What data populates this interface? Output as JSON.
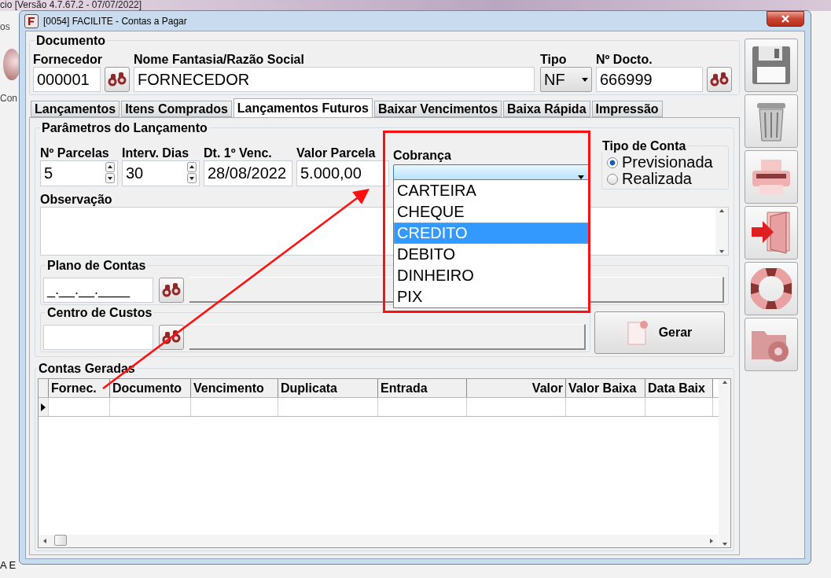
{
  "background_app": {
    "title": "cio [Versão 4.7.67.2 - 07/07/2022]",
    "side_texts": [
      "os",
      "Con"
    ],
    "status_text": "A E"
  },
  "window": {
    "title": "[0054] FACILITE - Contas a Pagar"
  },
  "documento": {
    "title": "Documento",
    "fields": [
      {
        "label": "Fornecedor",
        "value": "000001",
        "kind": "text",
        "lookup": true
      },
      {
        "label": "Nome Fantasia/Razão Social",
        "value": "FORNECEDOR",
        "kind": "text",
        "lookup": false
      },
      {
        "label": "Tipo",
        "value": "NF",
        "kind": "select",
        "lookup": false
      },
      {
        "label": "Nº Docto.",
        "value": "666999",
        "kind": "text",
        "lookup": true
      }
    ]
  },
  "tabs": [
    {
      "label": "Lançamentos",
      "selected": false
    },
    {
      "label": "Itens Comprados",
      "selected": false
    },
    {
      "label": "Lançamentos Futuros",
      "selected": true
    },
    {
      "label": "Baixar Vencimentos",
      "selected": false
    },
    {
      "label": "Baixa Rápida",
      "selected": false
    },
    {
      "label": "Impressão",
      "selected": false
    }
  ],
  "parametros": {
    "title": "Parâmetros do Lançamento",
    "fields": [
      {
        "label": "Nº Parcelas",
        "value": "5",
        "kind": "spin"
      },
      {
        "label": "Interv. Dias",
        "value": "30",
        "kind": "spin"
      },
      {
        "label": "Dt. 1º Venc.",
        "value": "28/08/2022",
        "kind": "text"
      },
      {
        "label": "Valor Parcela",
        "value": "5.000,00",
        "kind": "text"
      }
    ],
    "cobranca": {
      "label": "Cobrança",
      "expanded": true,
      "options": [
        {
          "label": "CARTEIRA",
          "selected": false
        },
        {
          "label": "CHEQUE",
          "selected": false
        },
        {
          "label": "CREDITO",
          "selected": true
        },
        {
          "label": "DEBITO",
          "selected": false
        },
        {
          "label": "DINHEIRO",
          "selected": false
        },
        {
          "label": "PIX",
          "selected": false
        }
      ]
    },
    "tipo_conta": {
      "title": "Tipo de Conta",
      "options": [
        {
          "label": "Previsionada",
          "selected": true
        },
        {
          "label": "Realizada",
          "selected": false
        }
      ]
    },
    "observacao": {
      "label": "Observação"
    },
    "plano_contas": {
      "title": "Plano de Contas",
      "value": "_.__.__.____"
    },
    "centro_custos": {
      "title": "Centro de Custos"
    },
    "gerar_button": "Gerar"
  },
  "contas_geradas": {
    "title": "Contas Geradas",
    "columns": [
      {
        "label": "Fornec.",
        "kind": "text"
      },
      {
        "label": "Documento",
        "kind": "text"
      },
      {
        "label": "Vencimento",
        "kind": "text"
      },
      {
        "label": "Duplicata",
        "kind": "text"
      },
      {
        "label": "Entrada",
        "kind": "text"
      },
      {
        "label": "Valor",
        "kind": "number"
      },
      {
        "label": "Valor Baixa",
        "kind": "text"
      },
      {
        "label": "Data Baix",
        "kind": "text"
      }
    ]
  },
  "toolbar": [
    {
      "kind": "save"
    },
    {
      "kind": "delete"
    },
    {
      "kind": "print"
    },
    {
      "kind": "exit"
    },
    {
      "kind": "help"
    },
    {
      "kind": "settings"
    }
  ]
}
